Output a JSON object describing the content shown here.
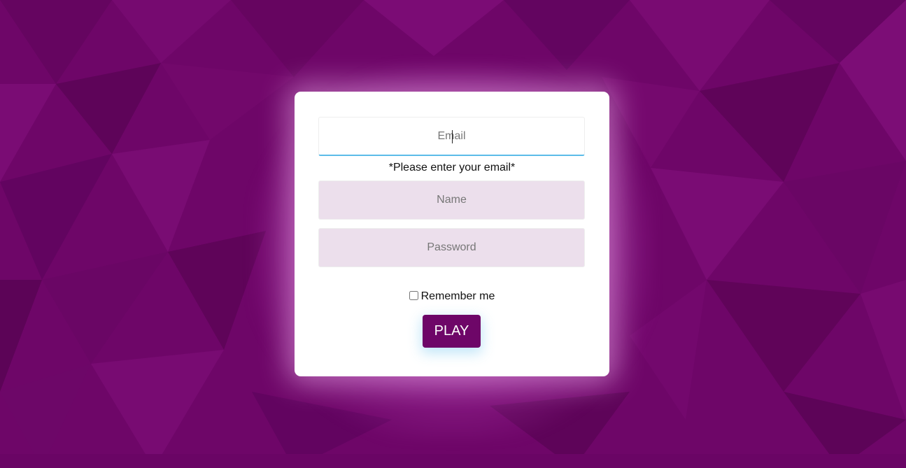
{
  "form": {
    "email_placeholder": "Email",
    "email_hint": "*Please enter your email*",
    "name_placeholder": "Name",
    "password_placeholder": "Password",
    "remember_label": "Remember me",
    "remember_checked": false,
    "play_label": "PLAY"
  },
  "colors": {
    "background": "#6e0668",
    "card": "#ffffff",
    "field_fill": "#ecdfec",
    "focus_underline": "#5bbce8",
    "button": "#6e0668",
    "button_text": "#ffffff"
  },
  "icons": {
    "background": "low-poly-triangle-pattern"
  }
}
